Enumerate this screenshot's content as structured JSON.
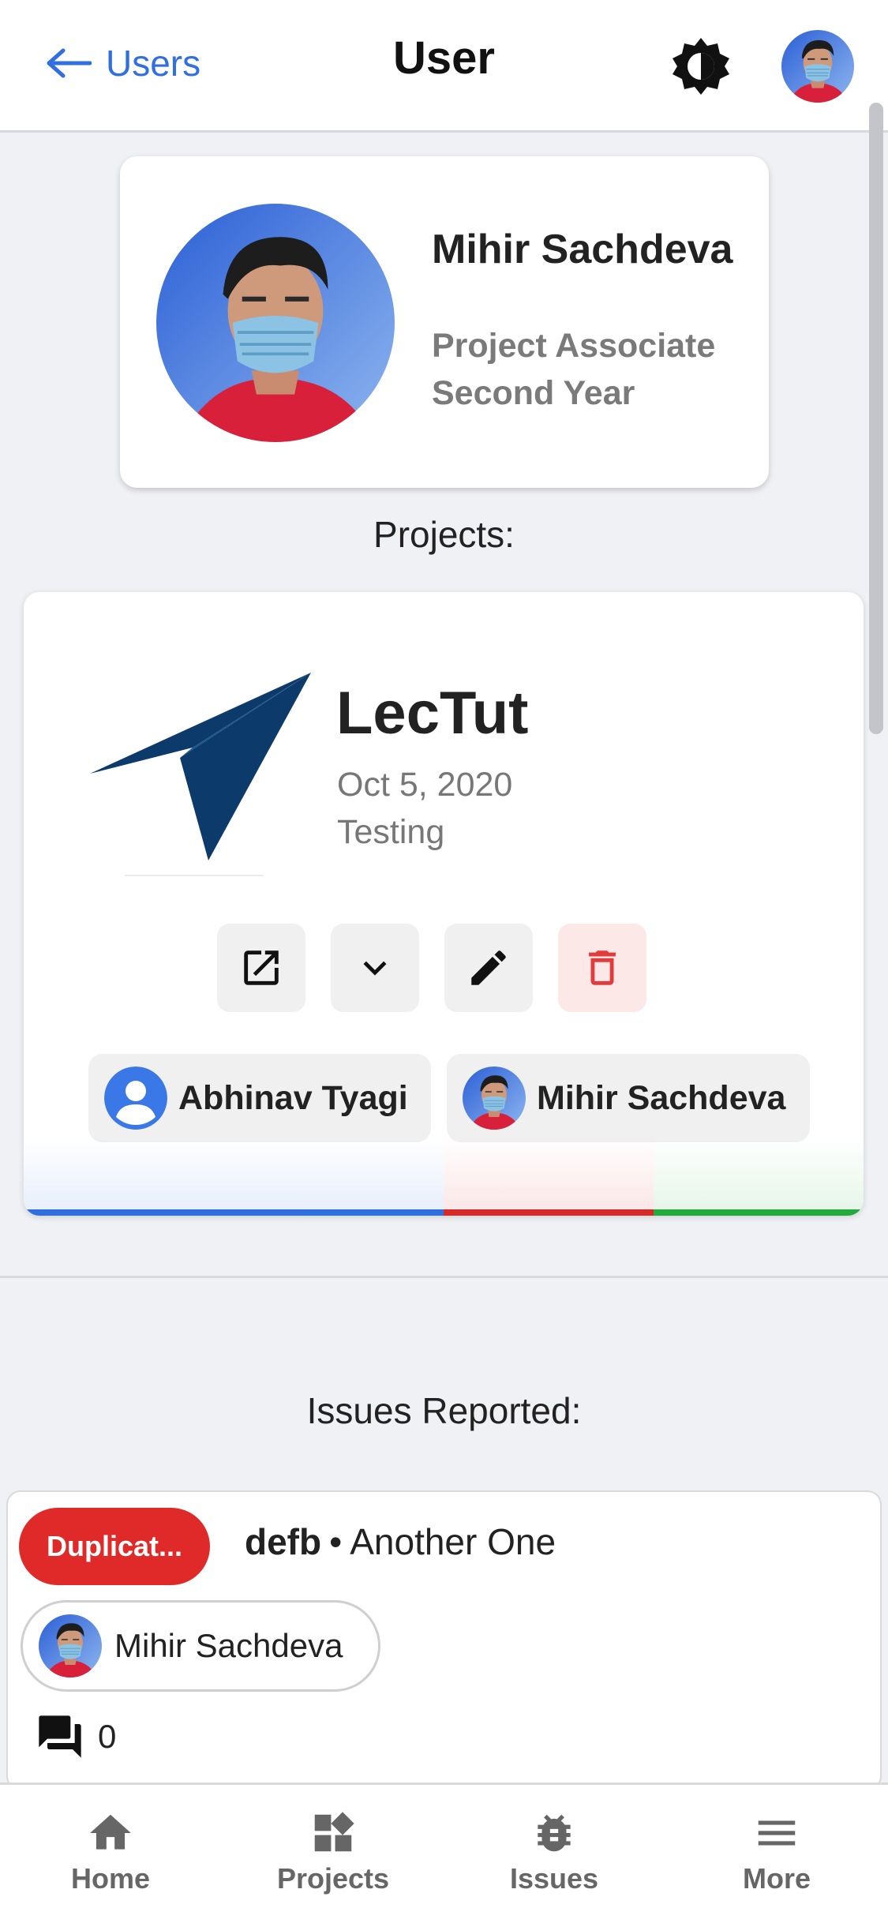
{
  "header": {
    "back_label": "Users",
    "title": "User"
  },
  "profile": {
    "name": "Mihir Sachdeva",
    "role_line1": "Project Associate",
    "role_line2": "Second Year"
  },
  "projects_heading": "Projects:",
  "project": {
    "name": "LecTut",
    "date": "Oct 5, 2020",
    "status": "Testing",
    "logo_color": "#0c3b6b",
    "actions": [
      "open-in-new",
      "expand",
      "edit",
      "delete"
    ],
    "members": [
      {
        "name": "Abhinav Tyagi",
        "avatar": "person-placeholder-icon"
      },
      {
        "name": "Mihir Sachdeva",
        "avatar": "user-photo"
      }
    ],
    "progress_segments": [
      {
        "color": "#2f6fe0",
        "fraction": 0.5
      },
      {
        "color": "#d42a2a",
        "fraction": 0.25
      },
      {
        "color": "#22aa3c",
        "fraction": 0.25
      }
    ]
  },
  "issues_heading": "Issues Reported:",
  "issue": {
    "badge": "Duplicat...",
    "badge_color": "#e02a2a",
    "project": "defb",
    "separator": "•",
    "title": "Another One",
    "reporter": "Mihir Sachdeva",
    "comment_count": "0"
  },
  "bottom_nav": [
    {
      "label": "Home",
      "icon": "home-icon"
    },
    {
      "label": "Projects",
      "icon": "projects-icon"
    },
    {
      "label": "Issues",
      "icon": "bug-icon"
    },
    {
      "label": "More",
      "icon": "menu-icon"
    }
  ],
  "colors": {
    "accent": "#2f6fe0",
    "background": "#f0f1f5",
    "danger": "#e02a2a"
  }
}
